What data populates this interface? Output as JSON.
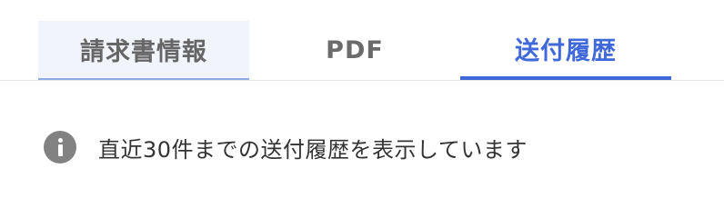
{
  "tabs": [
    {
      "label": "請求書情報",
      "state": "hover"
    },
    {
      "label": "PDF",
      "state": "default"
    },
    {
      "label": "送付履歴",
      "state": "active"
    }
  ],
  "notice": {
    "icon": "info-icon",
    "text": "直近30件までの送付履歴を表示しています"
  },
  "colors": {
    "accent": "#3f68d9",
    "hover_bg": "#f1f4fb",
    "icon_gray": "#828282"
  }
}
